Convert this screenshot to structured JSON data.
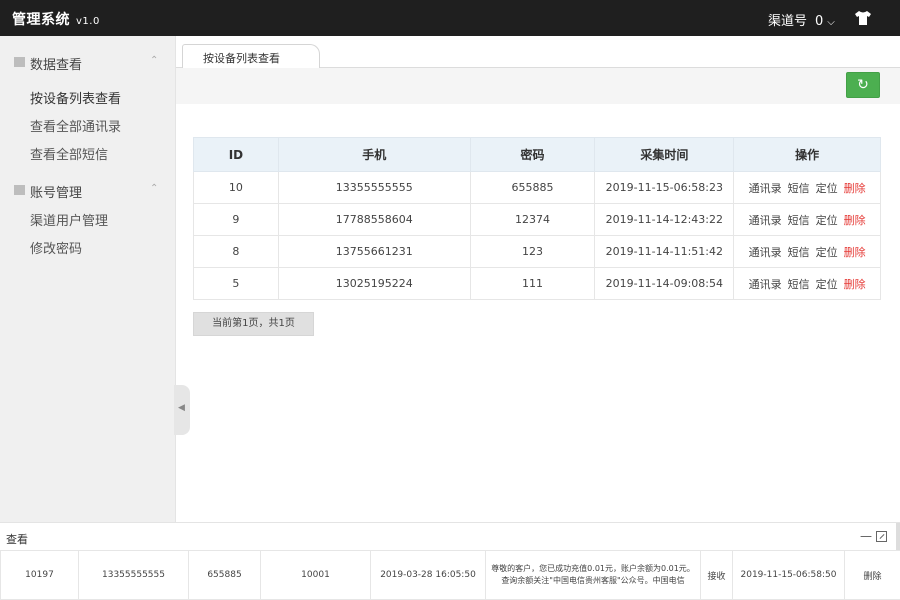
{
  "app": {
    "title": "管理系统",
    "version": "v1.0"
  },
  "header": {
    "channel_label": "渠道号",
    "channel_count": "0"
  },
  "sidebar": {
    "groups": [
      {
        "label": "数据查看",
        "items": [
          "按设备列表查看",
          "查看全部通讯录",
          "查看全部短信"
        ]
      },
      {
        "label": "账号管理",
        "items": [
          "渠道用户管理",
          "修改密码"
        ]
      }
    ]
  },
  "tabs": [
    {
      "label": "按设备列表查看"
    }
  ],
  "table": {
    "headers": [
      "ID",
      "手机",
      "密码",
      "采集时间",
      "操作"
    ],
    "rows": [
      {
        "id": "10",
        "phone": "13355555555",
        "password": "655885",
        "time": "2019-11-15-06:58:23"
      },
      {
        "id": "9",
        "phone": "17788558604",
        "password": "12374",
        "time": "2019-11-14-12:43:22"
      },
      {
        "id": "8",
        "phone": "13755661231",
        "password": "123",
        "time": "2019-11-14-11:51:42"
      },
      {
        "id": "5",
        "phone": "13025195224",
        "password": "111",
        "time": "2019-11-14-09:08:54"
      }
    ],
    "ops": {
      "contacts": "通讯录",
      "sms": "短信",
      "locate": "定位",
      "delete": "删除"
    }
  },
  "pager": {
    "text": "当前第1页，共1页"
  },
  "bottom_panel": {
    "title": "查看",
    "row": {
      "id": "10197",
      "phone": "13355555555",
      "password": "655885",
      "code": "10001",
      "sent_time": "2019-03-28 16:05:50",
      "message": "尊敬的客户，您已成功充值0.01元，账户余额为0.01元。查询余额关注\"中国电信贵州客服\"公众号。中国电信",
      "direction": "接收",
      "collect_time": "2019-11-15-06:58:50",
      "action": "删除"
    }
  },
  "colors": {
    "topbar": "#1f1f1f",
    "refresh": "#4caf50",
    "delete": "#e53935",
    "header_row": "#eaf2f8"
  }
}
